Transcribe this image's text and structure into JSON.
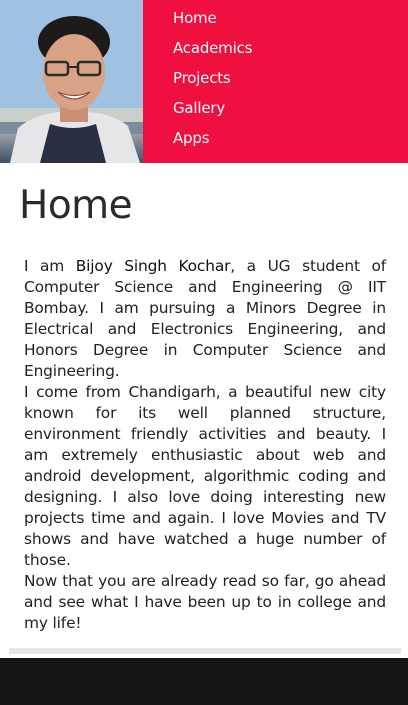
{
  "profile": {
    "photo_alt": "Profile photo"
  },
  "nav": {
    "items": [
      {
        "label": "Home"
      },
      {
        "label": "Academics"
      },
      {
        "label": "Projects"
      },
      {
        "label": "Gallery"
      },
      {
        "label": "Apps"
      }
    ]
  },
  "page": {
    "title": "Home"
  },
  "content": {
    "intro_prefix": "I am ",
    "name": "Bijoy Singh Kochar",
    "intro_suffix": ", a UG student of Computer Science and Engineering @ IIT Bombay. I am pursuing a Minors Degree in Electrical and Electronics Engineering, and Honors Degree in Computer Science and Engineering.",
    "paragraph2": "I come from Chandigarh, a beautiful new city known for its well planned structure, environment friendly activities and beauty. I am extremely enthusiastic about web and android development, algorithmic coding and designing. I also love doing interesting new projects time and again. I love Movies and TV shows and have watched a huge number of those.",
    "paragraph3": "Now that you are already read so far, go ahead and see what I have been up to in college and my life!"
  },
  "colors": {
    "nav_background": "#f0103f",
    "footer_background": "#141414"
  }
}
